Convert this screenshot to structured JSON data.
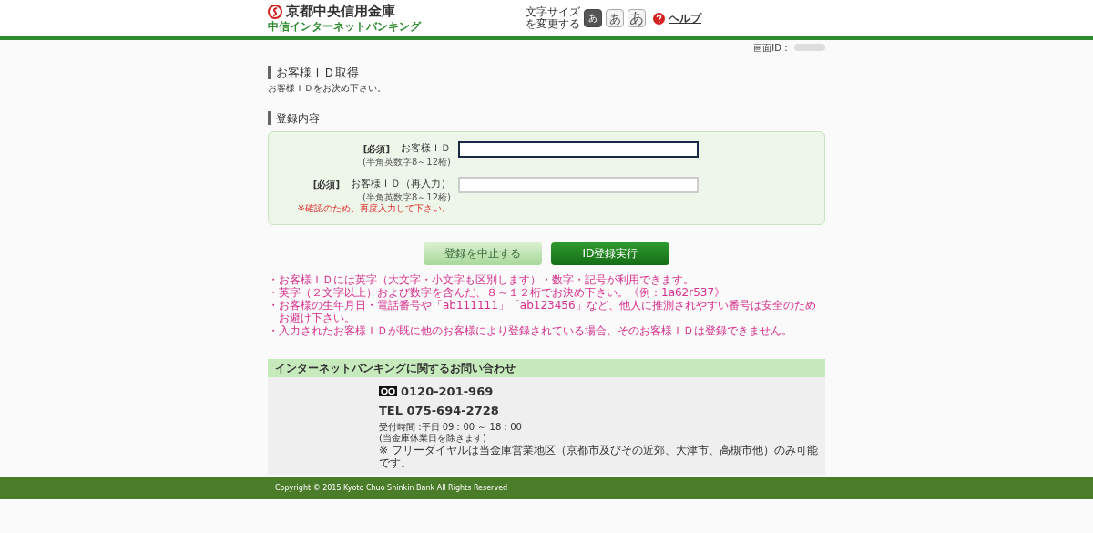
{
  "header": {
    "bank_name": "京都中央信用金庫",
    "service_name": "中信インターネットバンキング",
    "font_size_label": "文字サイズを変更する",
    "font_sizes": [
      {
        "label": "あ",
        "selected": true
      },
      {
        "label": "あ",
        "selected": false
      },
      {
        "label": "あ",
        "selected": false
      }
    ],
    "help": "ヘルプ"
  },
  "screen_id_label": "画面ID：",
  "page": {
    "title": "お客様ＩＤ取得",
    "description": "お客様ＩＤをお決め下さい。"
  },
  "form": {
    "section_title": "登録内容",
    "fields": [
      {
        "required": "[必須]",
        "label": "お客様ＩＤ",
        "hint": "(半角英数字8～12桁)",
        "focused": true
      },
      {
        "required": "[必須]",
        "label": "お客様ＩＤ（再入力）",
        "hint": "(半角英数字8～12桁)",
        "note": "※確認のため、再度入力して下さい。",
        "focused": false
      }
    ]
  },
  "buttons": [
    {
      "label": "登録を中止する",
      "kind": "cancel"
    },
    {
      "label": "ID登録実行",
      "kind": "submit"
    }
  ],
  "notes": [
    "・お客様ＩＤには英字（大文字・小文字も区別します）・数字・記号が利用できます。",
    "・英字（２文字以上）および数字を含んだ、８～１２桁でお決め下さい。《例：1a62r537》",
    "・お客様の生年月日・電話番号や「ab111111」「ab123456」など、他人に推測されやすい番号は安全のためお避け下さい。",
    "・入力されたお客様ＩＤが既に他のお客様により登録されている場合、そのお客様ＩＤは登録できません。"
  ],
  "contact": {
    "title": "インターネットバンキングに関するお問い合わせ",
    "free_dial": "0120-201-969",
    "tel": "TEL 075-694-2728",
    "hours": "受付時間 :平日 09：00 ～ 18：00",
    "holiday_note": "(当金庫休業日を除きます)",
    "free_dial_note": "※ フリーダイヤルは当金庫営業地区（京都市及びその近郊、大津市、高槻市他）のみ可能です。"
  },
  "footer": {
    "copyright": "Copyright © 2015 Kyoto Chuo Shinkin Bank All Rights Reserved"
  }
}
